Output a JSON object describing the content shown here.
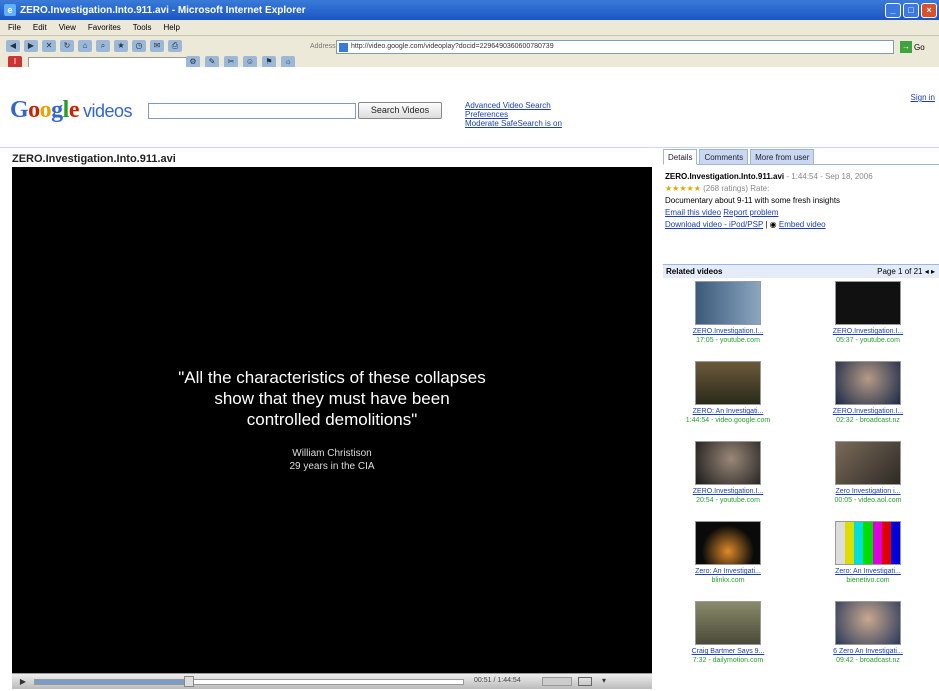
{
  "window": {
    "title": "ZERO.Investigation.Into.911.avi - Microsoft Internet Explorer"
  },
  "menu": [
    "File",
    "Edit",
    "View",
    "Favorites",
    "Tools",
    "Help"
  ],
  "address": {
    "label": "Address",
    "url": "http://video.google.com/videoplay?docid=2296490360600780739",
    "go": "Go"
  },
  "header": {
    "logo": {
      "G": "G",
      "o1": "o",
      "o2": "o",
      "g": "g",
      "l": "l",
      "e": "e",
      "videos": "videos"
    },
    "search_button": "Search Videos",
    "links": [
      "Advanced Video Search",
      "Preferences",
      "Moderate SafeSearch is on"
    ],
    "signin": "Sign in"
  },
  "video": {
    "title": "ZERO.Investigation.Into.911.avi",
    "quote_lines": [
      "\"All the characteristics of these collapses",
      "show that they must have been",
      "controlled demolitions\""
    ],
    "attribution_lines": [
      "William Christison",
      "29 years in the CIA"
    ],
    "progress": 0.37,
    "timer": "00:51 / 1:44:54"
  },
  "panel": {
    "tabs": [
      "Details",
      "Comments",
      "More from user"
    ],
    "details": {
      "title": "ZERO.Investigation.Into.911.avi",
      "meta": " - 1:44:54 - Sep 18, 2006",
      "stars": "★★★★★",
      "ratings": "(268 ratings) Rate:",
      "description": "Documentary about 9-11 with some fresh insights",
      "email": "Email this video",
      "report": "Report problem",
      "download": "Download video - iPod/PSP",
      "embed": "Embed video"
    },
    "related": {
      "label": "Related videos",
      "page": "Page 1 of 21"
    },
    "items": [
      {
        "title": "ZERO.Investigation.I...",
        "meta": "17:05 - youtube.com"
      },
      {
        "title": "ZERO.Investigation.I...",
        "meta": "05:37 - youtube.com"
      },
      {
        "title": "ZERO: An Investigati...",
        "meta": "1:44:54 - video.google.com"
      },
      {
        "title": "ZERO.Investigation.I...",
        "meta": "02:32 - broadcast.nz"
      },
      {
        "title": "ZERO.Investigation.I...",
        "meta": "20:54 - youtube.com"
      },
      {
        "title": "Zero Investigation i...",
        "meta": "00:05 - video.aol.com"
      },
      {
        "title": "Zero: An Investigati...",
        "meta": "blinkx.com"
      },
      {
        "title": "Zero: An Investigati...",
        "meta": "bienetivo.com"
      },
      {
        "title": "Craig Bartmer Says 9...",
        "meta": "7:32 - dailymotion.com"
      },
      {
        "title": "6 Zero An Investigati...",
        "meta": "09:42 - broadcast.nz"
      }
    ]
  }
}
